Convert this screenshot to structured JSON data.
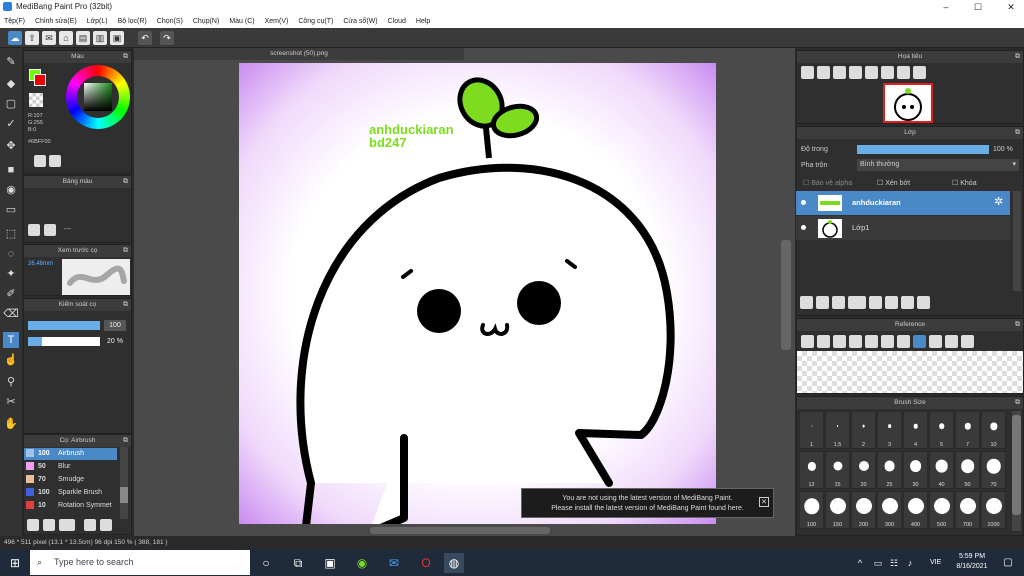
{
  "window": {
    "title": "MediBang Paint Pro (32bit)",
    "minimize": "–",
    "maximize": "☐",
    "close": "✕"
  },
  "menu": [
    "Tệp(F)",
    "Chỉnh sửa(E)",
    "Lớp(L)",
    "Bộ lọc(R)",
    "Chọn(S)",
    "Chụp(N)",
    "Màu (C)",
    "Xem(V)",
    "Công cụ(T)",
    "Cửa sổ(W)",
    "Cloud",
    "Help"
  ],
  "color_panel": {
    "title": "Màu",
    "rgb": "R:107\nG:255\nB:0",
    "hex": "#6BFF00",
    "fg_color": "#6BFF00",
    "accent": "#4a89c8"
  },
  "palette_panel": {
    "title": "Bảng màu",
    "dash": "---"
  },
  "preview_panel": {
    "title": "Xem trước cọ",
    "size": "26.46mm"
  },
  "brush_ctrl_panel": {
    "title": "Kiểm soát cọ",
    "size_value": "100",
    "opacity_value": "20 %",
    "size_fraction": 1.0,
    "opacity_fraction": 0.2
  },
  "brush_list_panel": {
    "title": "Cọ: Airbrush",
    "items": [
      {
        "size": "100",
        "name": "Airbrush",
        "color": "#9fc4e8"
      },
      {
        "size": "50",
        "name": "Blur",
        "color": "#f0a0f0"
      },
      {
        "size": "70",
        "name": "Smudge",
        "color": "#e8c0a0"
      },
      {
        "size": "100",
        "name": "Sparkle Brush",
        "color": "#4060e0"
      },
      {
        "size": "10",
        "name": "Rotation Symmet",
        "color": "#e04040"
      }
    ]
  },
  "document": {
    "tab": "screenshot (50).png",
    "watermark_line1": "anhduckiaran",
    "watermark_line2": "bd247"
  },
  "navigator": {
    "title": "Họa tiêu"
  },
  "layer_panel": {
    "title": "Lớp",
    "opacity_label": "Độ trong",
    "opacity_value": "100 %",
    "opacity_fraction": 1.0,
    "blend_label": "Pha trộn",
    "blend_value": "Bình thường",
    "protect_alpha": "Bảo vệ alpha",
    "clipping": "Xén bớt",
    "lock": "Khóa",
    "layers": [
      {
        "name": "anhduckiaran",
        "selected": true
      },
      {
        "name": "Lớp1",
        "selected": false
      }
    ]
  },
  "reference_panel": {
    "title": "Reference"
  },
  "brush_size_panel": {
    "title": "Brush Size",
    "sizes": [
      "1",
      "1.5",
      "2",
      "3",
      "4",
      "5",
      "7",
      "10",
      "12",
      "15",
      "20",
      "25",
      "30",
      "40",
      "50",
      "70",
      "100",
      "150",
      "200",
      "300",
      "400",
      "500",
      "700",
      "1000"
    ]
  },
  "notice": {
    "line1": "You are not using the latest version of MediBang Paint.",
    "line2": "Please install the latest version of MediBang Paint found here.",
    "close": "✕"
  },
  "status": {
    "text": "496 * 511 pixel   (13.1 * 13.5cm)   96 dpi   150 %   ( 388, 181 )"
  },
  "taskbar": {
    "search_placeholder": "Type here to search",
    "time": "5:59 PM",
    "date": "8/16/2021",
    "lang": "VIE"
  }
}
